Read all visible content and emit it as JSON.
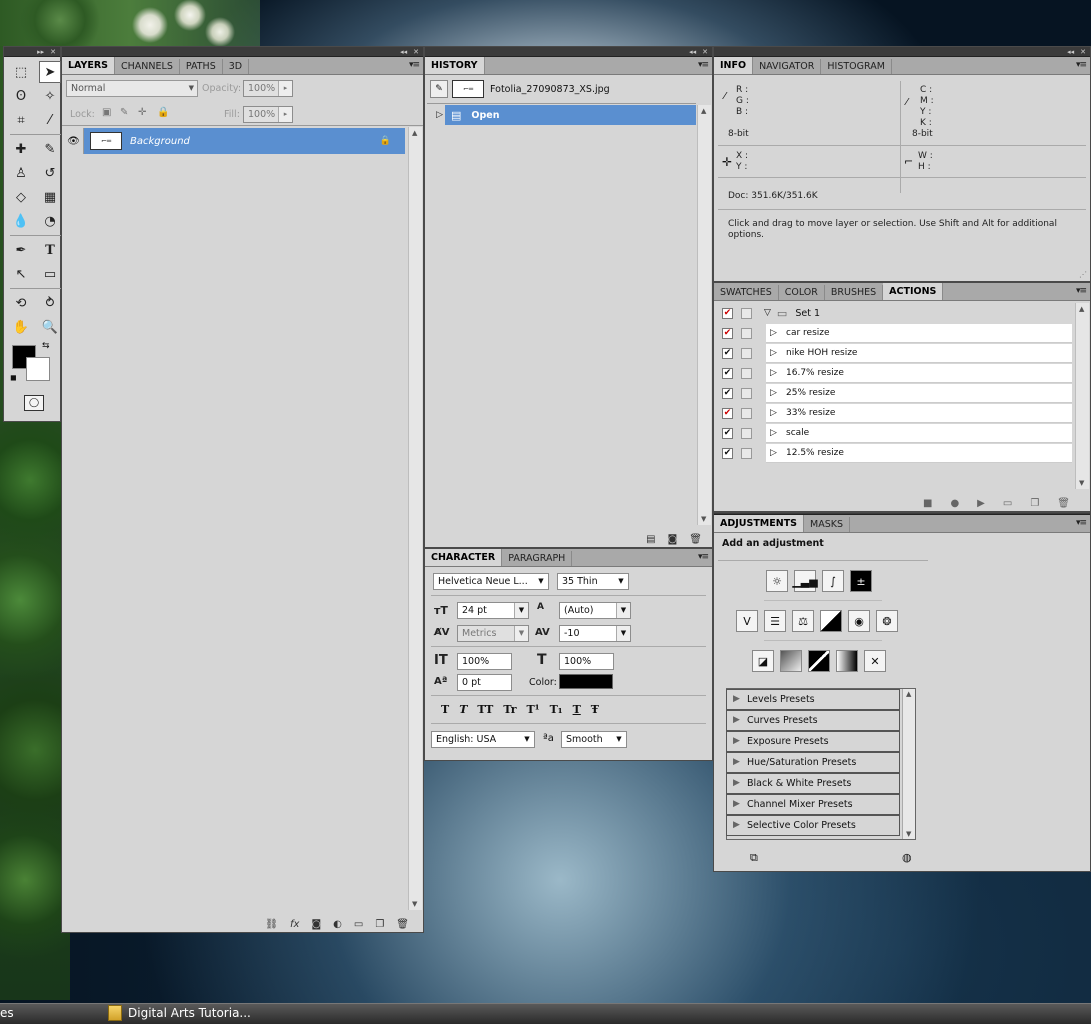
{
  "tools_panel": {
    "tools": [
      "marquee-icon",
      "move-icon",
      "lasso-icon",
      "magic-wand-icon",
      "crop-icon",
      "eyedropper-icon",
      "healing-icon",
      "brush-icon",
      "stamp-icon",
      "history-brush-icon",
      "eraser-icon",
      "gradient-icon",
      "blur-icon",
      "dodge-icon",
      "pen-icon",
      "type-icon",
      "path-select-icon",
      "shape-icon",
      "rotate-3d-icon",
      "orbit-3d-icon",
      "hand-icon",
      "zoom-icon"
    ],
    "colors": {
      "foreground": "#000000",
      "background": "#ffffff"
    }
  },
  "layers": {
    "tabs": [
      "LAYERS",
      "CHANNELS",
      "PATHS",
      "3D"
    ],
    "blend_mode": "Normal",
    "opacity_label": "Opacity:",
    "opacity": "100%",
    "lock_label": "Lock:",
    "fill_label": "Fill:",
    "fill": "100%",
    "layer_name": "Background"
  },
  "history": {
    "tabs": [
      "HISTORY"
    ],
    "snapshot": "Fotolia_27090873_XS.jpg",
    "step": "Open"
  },
  "info": {
    "tabs": [
      "INFO",
      "NAVIGATOR",
      "HISTOGRAM"
    ],
    "rgb": [
      "R :",
      "G :",
      "B :"
    ],
    "bit_left": "8-bit",
    "cmyk": [
      "C :",
      "M :",
      "Y :",
      "K :"
    ],
    "bit_right": "8-bit",
    "xy": [
      "X :",
      "Y :"
    ],
    "wh": [
      "W :",
      "H :"
    ],
    "doc": "Doc: 351.6K/351.6K",
    "hint": "Click and drag to move layer or selection.  Use Shift and Alt for additional options."
  },
  "actions": {
    "tabs": [
      "SWATCHES",
      "COLOR",
      "BRUSHES",
      "ACTIONS"
    ],
    "set_name": "Set 1",
    "items": [
      "car resize",
      "nike HOH resize",
      "16.7% resize",
      "25% resize",
      "33% resize",
      "scale",
      "12.5% resize"
    ]
  },
  "character": {
    "tabs": [
      "CHARACTER",
      "PARAGRAPH"
    ],
    "font_family": "Helvetica Neue L...",
    "font_style": "35 Thin",
    "size": "24 pt",
    "leading": "(Auto)",
    "kerning": "Metrics",
    "tracking": "-10",
    "vscale": "100%",
    "hscale": "100%",
    "baseline": "0 pt",
    "color_label": "Color:",
    "color": "#000000",
    "style_buttons": [
      "T",
      "T",
      "TT",
      "Tr",
      "T¹",
      "T₁",
      "T",
      "Ŧ"
    ],
    "language": "English: USA",
    "aa_label": "ªa",
    "antialias": "Smooth"
  },
  "adjustments": {
    "tabs": [
      "ADJUSTMENTS",
      "MASKS"
    ],
    "heading": "Add an adjustment",
    "presets": [
      "Levels Presets",
      "Curves Presets",
      "Exposure Presets",
      "Hue/Saturation Presets",
      "Black & White Presets",
      "Channel Mixer Presets",
      "Selective Color Presets"
    ]
  },
  "taskbar": {
    "left_fragment": "es",
    "window_label": "Digital Arts Tutoria..."
  }
}
